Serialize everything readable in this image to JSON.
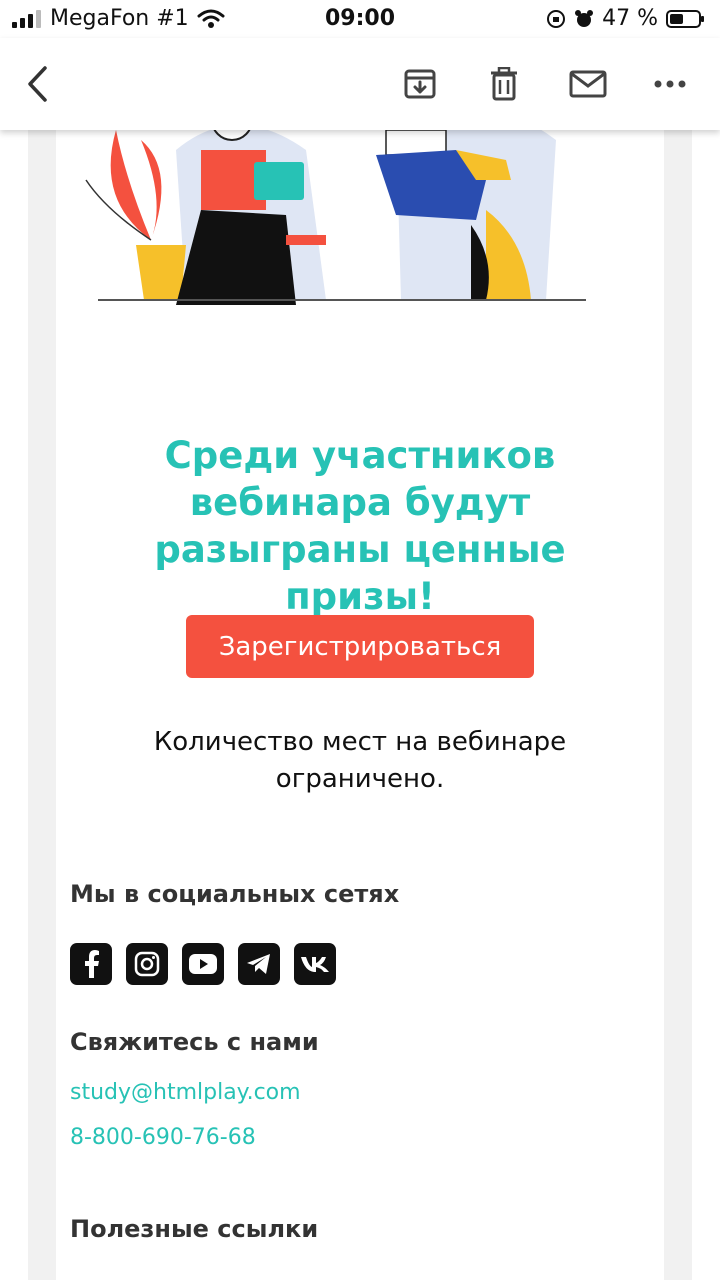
{
  "status_bar": {
    "carrier": "MegaFon #1",
    "time": "09:00",
    "battery": "47 %"
  },
  "toolbar": {
    "back_icon": "chevron-left-icon",
    "actions": [
      "archive-icon",
      "trash-icon",
      "mail-icon",
      "more-icon"
    ]
  },
  "email": {
    "headline": "Среди участников вебинара будут разыграны ценные призы!",
    "cta_label": "Зарегистрироваться",
    "notice": "Количество мест на вебинаре ограничено.",
    "social_title": "Мы в социальных сетях",
    "social_icons": [
      "facebook-icon",
      "instagram-icon",
      "youtube-icon",
      "telegram-icon",
      "vk-icon"
    ],
    "contact_title": "Свяжитесь с нами",
    "email": "study@htmlplay.com",
    "phone": "8-800-690-76-68",
    "links_title": "Полезные ссылки"
  },
  "colors": {
    "accent": "#27c2b5",
    "button": "#f4513f"
  }
}
